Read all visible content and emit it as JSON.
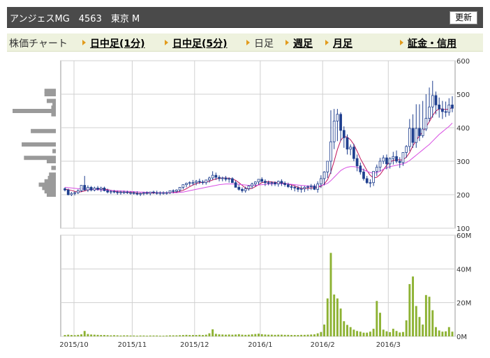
{
  "header": {
    "title": "アンジェスMG　4563　東京 M",
    "refresh_label": "更新"
  },
  "nav": {
    "label": "株価チャート",
    "items": [
      {
        "label": "日中足(1分)",
        "link": true
      },
      {
        "label": "日中足(5分)",
        "link": true
      },
      {
        "label": "日足",
        "link": false
      },
      {
        "label": "週足",
        "link": true
      },
      {
        "label": "月足",
        "link": true
      },
      {
        "label": "証金・信用",
        "link": true
      }
    ]
  },
  "colors": {
    "up_candle": "#ffffff",
    "down_candle": "#1f3f8f",
    "ma_short": "#c0135a",
    "ma_long": "#d84ee3",
    "volume": "#8db233",
    "volume_profile": "#9a9a9a",
    "grid": "#d0d0d0"
  },
  "chart_data": [
    {
      "type": "candlestick",
      "title": "",
      "x_tick_labels": [
        "2015/10",
        "2015/11",
        "2015/12",
        "2016/1",
        "2016/2",
        "2016/3"
      ],
      "y_tick_labels": [
        "600",
        "500",
        "400",
        "300",
        "200",
        "100"
      ],
      "ylim": [
        100,
        600
      ],
      "grid": true,
      "series": [
        {
          "kind": "ohlc",
          "dates": [
            "2015-10-01",
            "2015-10-02",
            "2015-10-05",
            "2015-10-06",
            "2015-10-07",
            "2015-10-08",
            "2015-10-09",
            "2015-10-13",
            "2015-10-14",
            "2015-10-15",
            "2015-10-16",
            "2015-10-19",
            "2015-10-20",
            "2015-10-21",
            "2015-10-22",
            "2015-10-23",
            "2015-10-26",
            "2015-10-27",
            "2015-10-28",
            "2015-10-29",
            "2015-10-30",
            "2015-11-02",
            "2015-11-04",
            "2015-11-05",
            "2015-11-06",
            "2015-11-09",
            "2015-11-10",
            "2015-11-11",
            "2015-11-12",
            "2015-11-13",
            "2015-11-16",
            "2015-11-17",
            "2015-11-18",
            "2015-11-19",
            "2015-11-20",
            "2015-11-24",
            "2015-11-25",
            "2015-11-26",
            "2015-11-27",
            "2015-11-30",
            "2015-12-01",
            "2015-12-02",
            "2015-12-03",
            "2015-12-04",
            "2015-12-07",
            "2015-12-08",
            "2015-12-09",
            "2015-12-10",
            "2015-12-11",
            "2015-12-14",
            "2015-12-15",
            "2015-12-16",
            "2015-12-17",
            "2015-12-18",
            "2015-12-21",
            "2015-12-22",
            "2015-12-24",
            "2015-12-25",
            "2015-12-28",
            "2015-12-30",
            "2016-01-04",
            "2016-01-05",
            "2016-01-06",
            "2016-01-07",
            "2016-01-08",
            "2016-01-12",
            "2016-01-13",
            "2016-01-14",
            "2016-01-15",
            "2016-01-18",
            "2016-01-19",
            "2016-01-20",
            "2016-01-21",
            "2016-01-22",
            "2016-01-25",
            "2016-01-26",
            "2016-01-27",
            "2016-01-28",
            "2016-01-29",
            "2016-02-01",
            "2016-02-02",
            "2016-02-03",
            "2016-02-04",
            "2016-02-05",
            "2016-02-08",
            "2016-02-09",
            "2016-02-10",
            "2016-02-12",
            "2016-02-15",
            "2016-02-16",
            "2016-02-17",
            "2016-02-18",
            "2016-02-19",
            "2016-02-22",
            "2016-02-23",
            "2016-02-24",
            "2016-02-25",
            "2016-02-26",
            "2016-02-29",
            "2016-03-01",
            "2016-03-02",
            "2016-03-03",
            "2016-03-04",
            "2016-03-07",
            "2016-03-08",
            "2016-03-09",
            "2016-03-10",
            "2016-03-11",
            "2016-03-14",
            "2016-03-15",
            "2016-03-16",
            "2016-03-17",
            "2016-03-18",
            "2016-03-22",
            "2016-03-23",
            "2016-03-24",
            "2016-03-25",
            "2016-03-28"
          ],
          "open": [
            218,
            214,
            200,
            204,
            206,
            212,
            228,
            214,
            222,
            214,
            220,
            216,
            220,
            212,
            208,
            210,
            208,
            206,
            208,
            208,
            206,
            206,
            204,
            202,
            204,
            206,
            204,
            208,
            206,
            204,
            206,
            206,
            206,
            212,
            210,
            214,
            222,
            230,
            234,
            236,
            236,
            240,
            238,
            236,
            244,
            250,
            258,
            252,
            248,
            250,
            246,
            248,
            236,
            222,
            216,
            212,
            218,
            226,
            232,
            238,
            246,
            240,
            236,
            234,
            236,
            232,
            240,
            234,
            230,
            224,
            222,
            220,
            216,
            218,
            222,
            224,
            226,
            216,
            232,
            248,
            268,
            300,
            358,
            420,
            440,
            392,
            370,
            336,
            342,
            308,
            286,
            268,
            248,
            236,
            236,
            270,
            282,
            300,
            310,
            292,
            308,
            314,
            300,
            296,
            326,
            344,
            398,
            356,
            398,
            376,
            396,
            428,
            462,
            496,
            468,
            456,
            448,
            446,
            468
          ],
          "high": [
            222,
            218,
            208,
            210,
            216,
            222,
            256,
            228,
            226,
            224,
            226,
            224,
            224,
            218,
            214,
            214,
            212,
            212,
            212,
            212,
            210,
            210,
            210,
            206,
            208,
            210,
            208,
            212,
            212,
            210,
            210,
            210,
            212,
            216,
            216,
            220,
            230,
            236,
            240,
            244,
            244,
            248,
            244,
            244,
            254,
            270,
            266,
            258,
            254,
            256,
            252,
            252,
            242,
            230,
            222,
            224,
            228,
            236,
            240,
            246,
            252,
            246,
            242,
            240,
            240,
            242,
            246,
            240,
            236,
            230,
            228,
            226,
            226,
            226,
            228,
            232,
            232,
            240,
            258,
            270,
            294,
            452,
            456,
            456,
            446,
            404,
            380,
            350,
            352,
            320,
            296,
            278,
            256,
            246,
            258,
            290,
            310,
            318,
            320,
            312,
            328,
            332,
            312,
            312,
            348,
            426,
            440,
            470,
            470,
            480,
            500,
            520,
            540,
            508,
            490,
            480,
            478,
            488,
            494
          ],
          "low": [
            210,
            198,
            196,
            198,
            202,
            208,
            212,
            208,
            210,
            210,
            212,
            208,
            210,
            204,
            202,
            204,
            200,
            200,
            202,
            202,
            200,
            200,
            198,
            196,
            198,
            200,
            198,
            202,
            200,
            198,
            200,
            200,
            202,
            204,
            206,
            208,
            216,
            222,
            226,
            228,
            228,
            232,
            230,
            230,
            236,
            244,
            244,
            240,
            240,
            240,
            236,
            236,
            222,
            212,
            206,
            206,
            212,
            218,
            224,
            230,
            236,
            226,
            228,
            226,
            226,
            224,
            226,
            224,
            220,
            214,
            210,
            208,
            206,
            208,
            212,
            214,
            214,
            206,
            220,
            228,
            250,
            262,
            336,
            360,
            360,
            340,
            320,
            318,
            300,
            270,
            260,
            242,
            232,
            222,
            226,
            256,
            270,
            292,
            276,
            278,
            290,
            294,
            280,
            286,
            310,
            330,
            340,
            340,
            360,
            370,
            390,
            418,
            430,
            440,
            430,
            426,
            432,
            436,
            446
          ],
          "close": [
            214,
            200,
            204,
            206,
            212,
            228,
            214,
            222,
            214,
            220,
            216,
            220,
            212,
            208,
            210,
            208,
            206,
            208,
            208,
            206,
            206,
            204,
            202,
            204,
            206,
            204,
            208,
            206,
            204,
            206,
            206,
            206,
            212,
            210,
            214,
            222,
            230,
            234,
            236,
            236,
            240,
            238,
            236,
            244,
            250,
            258,
            252,
            248,
            250,
            246,
            248,
            236,
            222,
            216,
            212,
            218,
            226,
            232,
            238,
            246,
            240,
            236,
            234,
            236,
            232,
            240,
            234,
            230,
            224,
            222,
            220,
            216,
            218,
            222,
            224,
            226,
            216,
            232,
            248,
            268,
            300,
            358,
            420,
            440,
            392,
            370,
            336,
            342,
            308,
            286,
            268,
            248,
            236,
            236,
            270,
            282,
            300,
            310,
            292,
            308,
            314,
            300,
            296,
            326,
            344,
            398,
            356,
            398,
            376,
            396,
            428,
            462,
            496,
            468,
            456,
            448,
            446,
            468,
            458
          ]
        },
        {
          "kind": "moving_average",
          "name": "",
          "color_key": "ma_short",
          "values": [
            216,
            215,
            213,
            210,
            208,
            209,
            211,
            214,
            216,
            216,
            217,
            218,
            217,
            215,
            213,
            211,
            209,
            208,
            208,
            207,
            207,
            206,
            205,
            204,
            204,
            205,
            205,
            205,
            206,
            205,
            205,
            205,
            206,
            207,
            208,
            210,
            213,
            218,
            224,
            229,
            233,
            236,
            237,
            238,
            240,
            244,
            247,
            249,
            250,
            250,
            249,
            247,
            243,
            236,
            228,
            220,
            217,
            219,
            224,
            230,
            236,
            238,
            239,
            238,
            237,
            236,
            236,
            234,
            232,
            229,
            226,
            222,
            219,
            218,
            219,
            220,
            221,
            222,
            225,
            232,
            245,
            268,
            300,
            335,
            362,
            374,
            372,
            364,
            350,
            330,
            308,
            290,
            272,
            258,
            250,
            252,
            260,
            274,
            288,
            298,
            302,
            305,
            304,
            304,
            312,
            326,
            346,
            362,
            376,
            388,
            402,
            418,
            436,
            450,
            456,
            456,
            454,
            456,
            460
          ]
        },
        {
          "kind": "moving_average",
          "name": "",
          "color_key": "ma_long",
          "values": [
            222,
            221,
            220,
            219,
            218,
            217,
            217,
            216,
            216,
            215,
            215,
            214,
            214,
            213,
            213,
            212,
            212,
            211,
            211,
            210,
            210,
            209,
            209,
            208,
            208,
            207,
            207,
            207,
            206,
            206,
            206,
            206,
            206,
            206,
            206,
            207,
            208,
            210,
            212,
            214,
            216,
            218,
            220,
            222,
            224,
            226,
            228,
            230,
            231,
            232,
            232,
            232,
            232,
            231,
            230,
            229,
            228,
            228,
            228,
            229,
            230,
            231,
            232,
            232,
            233,
            233,
            233,
            233,
            232,
            231,
            230,
            229,
            228,
            227,
            226,
            226,
            225,
            226,
            227,
            230,
            234,
            242,
            252,
            262,
            272,
            278,
            282,
            284,
            284,
            282,
            278,
            274,
            270,
            266,
            264,
            266,
            270,
            276,
            280,
            284,
            286,
            288,
            290,
            292,
            296,
            302,
            310,
            318,
            326,
            334,
            342,
            350,
            360,
            370,
            380,
            388,
            396,
            404,
            414
          ]
        }
      ]
    },
    {
      "type": "bar",
      "title": "",
      "y_tick_labels": [
        "60M",
        "40M",
        "20M",
        "0M"
      ],
      "ylim": [
        0,
        60
      ],
      "unit": "M",
      "values": [
        0.8,
        1.0,
        0.8,
        0.7,
        0.9,
        1.2,
        3.2,
        1.4,
        1.1,
        1.0,
        0.9,
        0.8,
        0.8,
        0.7,
        0.6,
        0.7,
        0.6,
        0.5,
        0.6,
        0.6,
        0.5,
        0.5,
        0.4,
        0.5,
        0.5,
        0.4,
        0.5,
        0.5,
        0.5,
        0.4,
        0.4,
        0.5,
        0.6,
        0.6,
        0.6,
        0.7,
        0.8,
        0.9,
        0.8,
        0.8,
        0.8,
        0.9,
        0.8,
        1.0,
        1.8,
        4.2,
        1.5,
        1.2,
        1.1,
        1.0,
        1.1,
        1.0,
        1.1,
        1.3,
        1.0,
        0.9,
        1.0,
        1.2,
        1.4,
        1.6,
        1.3,
        1.1,
        1.0,
        1.0,
        0.9,
        1.0,
        1.0,
        0.9,
        0.9,
        0.8,
        0.8,
        0.8,
        0.9,
        0.9,
        1.0,
        1.1,
        1.2,
        1.8,
        2.6,
        7.0,
        22.5,
        49.5,
        24.8,
        22.5,
        16.5,
        9.0,
        6.8,
        5.5,
        4.0,
        3.2,
        2.8,
        2.2,
        2.2,
        2.8,
        4.5,
        21.0,
        14.0,
        4.0,
        3.0,
        2.5,
        4.5,
        3.2,
        2.3,
        2.6,
        9.5,
        31.0,
        35.5,
        18.0,
        11.5,
        7.0,
        24.5,
        23.5,
        15.5,
        5.5,
        3.5,
        2.8,
        3.0,
        5.5,
        2.8
      ]
    },
    {
      "type": "bar",
      "orientation": "horizontal",
      "title": "",
      "description_key": "volume_profile",
      "ylim": [
        100,
        600
      ],
      "price_bins": [
        530,
        520,
        510,
        500,
        490,
        480,
        470,
        460,
        450,
        440,
        430,
        420,
        410,
        400,
        390,
        380,
        370,
        360,
        350,
        340,
        330,
        320,
        310,
        300,
        290,
        280,
        270,
        260,
        250,
        240,
        230,
        220,
        210,
        200
      ],
      "values": [
        0,
        0,
        10,
        10,
        0,
        8,
        3,
        4,
        38,
        4,
        0,
        0,
        0,
        0,
        22,
        0,
        0,
        0,
        30,
        0,
        3,
        0,
        28,
        8,
        0,
        4,
        0,
        6,
        7,
        10,
        15,
        12,
        10,
        8
      ]
    }
  ]
}
